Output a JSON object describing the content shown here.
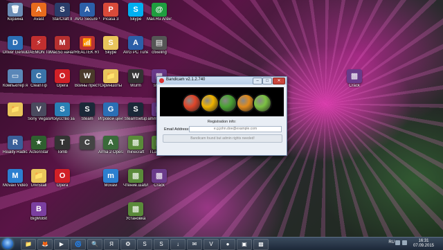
{
  "dialog": {
    "title": "Bandicam v2.1.2.740",
    "reg_info_label": "Registration info:",
    "email_label": "Email Address:",
    "email_placeholder": "e.g.john.doe@example.com",
    "register_button": "Bandicam found but admin rights needed!",
    "min": "–",
    "max": "□",
    "close": "✕",
    "logo_colors": [
      "#e0462a",
      "#f0b400",
      "#4aa233",
      "#e08a1c",
      "#7cc242"
    ]
  },
  "desktop_icons": [
    {
      "label": "Корзина",
      "glyph": "🗑",
      "color": "#6b8db5",
      "icon": "recycle-bin-icon"
    },
    {
      "label": "Driver Genius Pro",
      "glyph": "D",
      "color": "#2b6fb5",
      "icon": "driver-genius-icon"
    },
    {
      "label": "Компьютер ярлык",
      "glyph": "▭",
      "color": "#5a87b8",
      "icon": "computer-icon"
    },
    {
      "label": "",
      "glyph": "📁",
      "color": "#e9c55b",
      "icon": "folder-icon"
    },
    {
      "label": "Reality Radical",
      "glyph": "R",
      "color": "#3a5f9a",
      "icon": "app-icon"
    },
    {
      "label": "Movavi Video Su",
      "glyph": "M",
      "color": "#2c7fd0",
      "icon": "movavi-icon"
    },
    {
      "label": "Avast",
      "glyph": "A",
      "color": "#e86b1d",
      "icon": "avast-icon"
    },
    {
      "label": "DAEMON Tools Pr",
      "glyph": "⚡",
      "color": "#c12f2f",
      "icon": "daemon-tools-icon"
    },
    {
      "label": "CleanTip",
      "glyph": "C",
      "color": "#3b74a8",
      "icon": "app-icon"
    },
    {
      "label": "Sony Vegas",
      "glyph": "V",
      "color": "#4a4a5e",
      "icon": "app-icon"
    },
    {
      "label": "ActionStar",
      "glyph": "★",
      "color": "#2f5f2f",
      "icon": "app-icon"
    },
    {
      "label": "Uninstall",
      "glyph": "📁",
      "color": "#e9c55b",
      "icon": "folder-icon"
    },
    {
      "label": "BigMoBit",
      "glyph": "B",
      "color": "#7b3fa0",
      "icon": "app-icon"
    },
    {
      "label": "StarCraft II",
      "glyph": "S",
      "color": "#2a3d6a",
      "icon": "starcraft-icon"
    },
    {
      "label": "MacSo начальни",
      "glyph": "M",
      "color": "#b53030",
      "icon": "app-icon"
    },
    {
      "label": "Opera",
      "glyph": "O",
      "color": "#d12027",
      "icon": "opera-icon"
    },
    {
      "label": "Искусство защиты",
      "glyph": "S",
      "color": "#2a7fb5",
      "icon": "app-icon"
    },
    {
      "label": "Tomb",
      "glyph": "T",
      "color": "#333",
      "icon": "app-icon"
    },
    {
      "label": "Opera",
      "glyph": "O",
      "color": "#d12027",
      "icon": "opera-icon"
    },
    {
      "label": "AVG Secure VPN",
      "glyph": "A",
      "color": "#2c5fa8",
      "icon": "avg-icon"
    },
    {
      "label": "REALTEK RTL8192U",
      "glyph": "📶",
      "color": "#b33",
      "icon": "realtek-icon"
    },
    {
      "label": "Войны престолов",
      "glyph": "W",
      "color": "#4a3a2a",
      "icon": "app-icon"
    },
    {
      "label": "Steam",
      "glyph": "S",
      "color": "#1b2838",
      "icon": "steam-icon"
    },
    {
      "label": "",
      "glyph": "C",
      "color": "#444",
      "icon": "cs-icon"
    },
    {
      "label": "Picasa 3",
      "glyph": "P",
      "color": "#d94a3a",
      "icon": "picasa-icon"
    },
    {
      "label": "Skype",
      "glyph": "S",
      "color": "#e9c55b",
      "icon": "folder-icon"
    },
    {
      "label": "Скриншоты",
      "glyph": "📁",
      "color": "#e9c55b",
      "icon": "folder-icon"
    },
    {
      "label": "Игровой центр@Mail",
      "glyph": "G",
      "color": "#2b6fb5",
      "icon": "app-icon"
    },
    {
      "label": "Arma 2 Operatio",
      "glyph": "A",
      "color": "#3a6a3a",
      "icon": "app-icon"
    },
    {
      "label": "Movavi",
      "glyph": "m",
      "color": "#2c7fd0",
      "icon": "movavi-icon"
    },
    {
      "label": "Skype",
      "glyph": "S",
      "color": "#00aff0",
      "icon": "skype-icon"
    },
    {
      "label": "AVG PC TuneUp 2015",
      "glyph": "A",
      "color": "#2c5fa8",
      "icon": "avg-icon"
    },
    {
      "label": "Wurm",
      "glyph": "W",
      "color": "#333",
      "icon": "app-icon"
    },
    {
      "label": "SteamSetup",
      "glyph": "S",
      "color": "#1b2838",
      "icon": "steam-icon"
    },
    {
      "label": "minecraft",
      "glyph": "▩",
      "color": "#5a8a3a",
      "icon": "minecraft-icon"
    },
    {
      "label": "Чтение.шабл",
      "glyph": "▩",
      "color": "#5a8a3a",
      "icon": "app-icon"
    },
    {
      "label": "Установка",
      "glyph": "▩",
      "color": "#5a8a3a",
      "icon": "app-icon"
    },
    {
      "label": "Mail.Ru Агент",
      "glyph": "@",
      "color": "#1f9d3f",
      "icon": "mail-agent-icon"
    },
    {
      "label": "cfixeling",
      "glyph": "▤",
      "color": "#555",
      "icon": "app-icon"
    },
    {
      "label": "steam",
      "glyph": "▩",
      "color": "#6a3a8a",
      "icon": "rar-icon"
    },
    {
      "label": "ammo/-pac..",
      "glyph": "▩",
      "color": "#6a3a8a",
      "icon": "rar-icon"
    },
    {
      "label": "TLauncher",
      "glyph": "▩",
      "color": "#5a8a3a",
      "icon": "minecraft-icon"
    },
    {
      "label": "Crack",
      "glyph": "▩",
      "color": "#6a3a8a",
      "icon": "rar-icon"
    }
  ],
  "right_icon": {
    "label": "Crack",
    "glyph": "▩",
    "color": "#6a3a8a"
  },
  "taskbar": {
    "items": [
      {
        "glyph": "📁",
        "icon": "explorer-icon"
      },
      {
        "glyph": "🦊",
        "icon": "firefox-icon"
      },
      {
        "glyph": "▶",
        "icon": "media-player-icon"
      },
      {
        "glyph": "🌀",
        "icon": "ie-icon"
      },
      {
        "glyph": "🔍",
        "icon": "search-icon"
      },
      {
        "glyph": "Я",
        "icon": "yandex-icon"
      },
      {
        "glyph": "❂",
        "icon": "chrome-icon"
      },
      {
        "glyph": "S",
        "icon": "skype-icon"
      },
      {
        "glyph": "S",
        "icon": "steam-icon"
      },
      {
        "glyph": "↓",
        "icon": "utorrent-icon"
      },
      {
        "glyph": "✉",
        "icon": "mail-icon"
      },
      {
        "glyph": "V",
        "icon": "vegas-icon"
      },
      {
        "glyph": "●",
        "icon": "bandicam-icon"
      },
      {
        "glyph": "▣",
        "icon": "app-icon"
      },
      {
        "glyph": "▩",
        "icon": "winrar-icon"
      }
    ],
    "lang": "RU",
    "time": "16:31",
    "date": "07.09.2015"
  }
}
